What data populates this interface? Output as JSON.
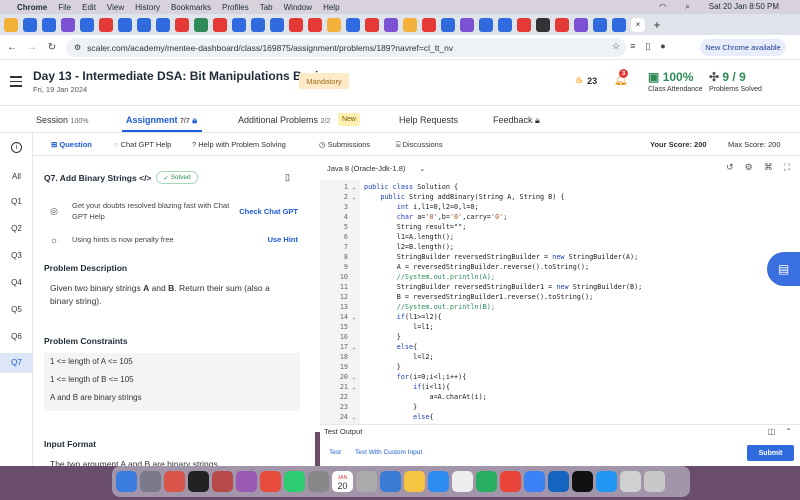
{
  "menubar": {
    "app": "Chrome",
    "items": [
      "File",
      "Edit",
      "View",
      "History",
      "Bookmarks",
      "Profiles",
      "Tab",
      "Window",
      "Help"
    ],
    "datetime": "Sat 20 Jan  8:50 PM"
  },
  "browser": {
    "url": "scaler.com/academy/mentee-dashboard/class/169875/assignment/problems/189?navref=cl_tt_nv",
    "new_chrome": "New Chrome available"
  },
  "header": {
    "title": "Day 13 - Intermediate DSA: Bit Manipulations Basics",
    "date": "Fri, 19 Jan 2024",
    "mandatory": "Mandatory",
    "coins": "23",
    "notif_count": "3",
    "attendance_value": "100%",
    "attendance_label": "Class Attendance",
    "solved_value": "9 / 9",
    "solved_label": "Problems Solved"
  },
  "subnav": {
    "session": "Session",
    "session_pct": "100%",
    "assignment": "Assignment",
    "assignment_count": "7/7",
    "additional": "Additional Problems",
    "additional_count": "2/2",
    "new_badge": "New",
    "help": "Help Requests",
    "feedback": "Feedback"
  },
  "rail": {
    "all": "All",
    "items": [
      "Q1",
      "Q2",
      "Q3",
      "Q4",
      "Q5",
      "Q6",
      "Q7"
    ]
  },
  "ptabs": {
    "question": "Question",
    "chatgpt": "Chat GPT Help",
    "help_solving": "Help with Problem Solving",
    "submissions": "Submissions",
    "discussions": "Discussions",
    "your_score": "Your Score: 200",
    "max_score": "Max Score: 200"
  },
  "problem": {
    "title": "Q7. Add Binary Strings",
    "solved": "Solved",
    "chat_text": "Get your doubts resolved blazing fast with Chat GPT Help",
    "chat_link": "Check Chat GPT",
    "hint_text": "Using hints is now penalty free",
    "hint_link": "Use Hint",
    "desc_h": "Problem Description",
    "desc_pre": "Given two binary strings ",
    "desc_a": "A",
    "desc_and": " and ",
    "desc_b": "B",
    "desc_post": ". Return their sum (also a binary string).",
    "constraints_h": "Problem Constraints",
    "constraints": [
      "1 <= length of A <= 105",
      "1 <= length of B <= 105",
      "A and B are binary strings"
    ],
    "input_h": "Input Format",
    "input_text": "The two argument A and B are binary strings"
  },
  "editor": {
    "language": "Java 8 (Oracle-Jdk-1.8)",
    "lines": [
      {
        "n": "1",
        "f": "⌄",
        "t": "public class Solution {"
      },
      {
        "n": "2",
        "f": "⌄",
        "t": "    public String addBinary(String A, String B) {"
      },
      {
        "n": "3",
        "f": "",
        "t": "        int i,l1=0,l2=0,l=0;"
      },
      {
        "n": "4",
        "f": "",
        "t": "        char a='0',b='0',carry='0';"
      },
      {
        "n": "5",
        "f": "",
        "t": "        String result=\"\";"
      },
      {
        "n": "6",
        "f": "",
        "t": "        l1=A.length();"
      },
      {
        "n": "7",
        "f": "",
        "t": "        l2=B.length();"
      },
      {
        "n": "8",
        "f": "",
        "t": "        StringBuilder reversedStringBuilder = new StringBuilder(A);"
      },
      {
        "n": "9",
        "f": "",
        "t": "        A = reversedStringBuilder.reverse().toString();"
      },
      {
        "n": "10",
        "f": "",
        "t": "        //System.out.println(A);"
      },
      {
        "n": "11",
        "f": "",
        "t": "        StringBuilder reversedStringBuilder1 = new StringBuilder(B);"
      },
      {
        "n": "12",
        "f": "",
        "t": "        B = reversedStringBuilder1.reverse().toString();"
      },
      {
        "n": "13",
        "f": "",
        "t": "        //System.out.println(B);"
      },
      {
        "n": "14",
        "f": "⌄",
        "t": "        if(l1>=l2){"
      },
      {
        "n": "15",
        "f": "",
        "t": "            l=l1;"
      },
      {
        "n": "16",
        "f": "",
        "t": "        }"
      },
      {
        "n": "17",
        "f": "⌄",
        "t": "        else{"
      },
      {
        "n": "18",
        "f": "",
        "t": "            l=l2;"
      },
      {
        "n": "19",
        "f": "",
        "t": "        }"
      },
      {
        "n": "20",
        "f": "⌄",
        "t": "        for(i=0;i<l;i++){"
      },
      {
        "n": "21",
        "f": "⌄",
        "t": "            if(i<l1){"
      },
      {
        "n": "22",
        "f": "",
        "t": "                a=A.charAt(i);"
      },
      {
        "n": "23",
        "f": "",
        "t": "            }"
      },
      {
        "n": "24",
        "f": "⌄",
        "t": "            else{"
      }
    ]
  },
  "testout": {
    "title": "Test Output",
    "test": "Test",
    "custom": "Test With Custom Input",
    "submit": "Submit"
  },
  "dock": {
    "calendar_month": "JAN",
    "calendar_day": "20"
  }
}
